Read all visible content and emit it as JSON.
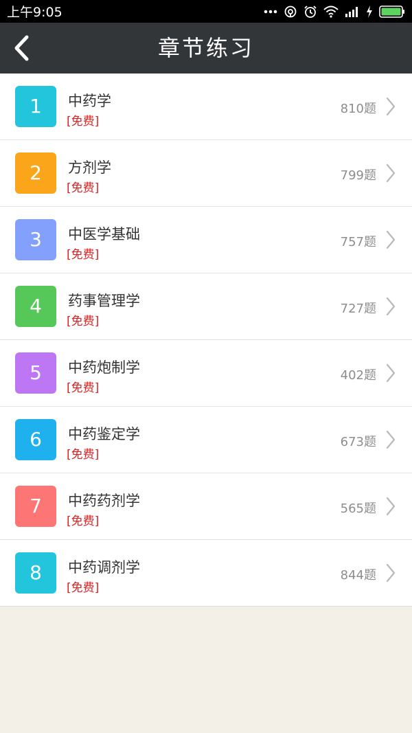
{
  "status_bar": {
    "time": "上午9:05",
    "icons": [
      "more-dots-icon",
      "sync-icon",
      "alarm-icon",
      "wifi-icon",
      "signal-icon",
      "charging-icon",
      "battery-icon"
    ]
  },
  "header": {
    "title": "章节练习",
    "back_icon": "chevron-left-icon"
  },
  "chapters": [
    {
      "num": "1",
      "name": "中药学",
      "tag": "[免费]",
      "count": "810题",
      "color": "#22c5db"
    },
    {
      "num": "2",
      "name": "方剂学",
      "tag": "[免费]",
      "count": "799题",
      "color": "#fba61a"
    },
    {
      "num": "3",
      "name": "中医学基础",
      "tag": "[免费]",
      "count": "757题",
      "color": "#84a0fd"
    },
    {
      "num": "4",
      "name": "药事管理学",
      "tag": "[免费]",
      "count": "727题",
      "color": "#55c859"
    },
    {
      "num": "5",
      "name": "中药炮制学",
      "tag": "[免费]",
      "count": "402题",
      "color": "#bd77f5"
    },
    {
      "num": "6",
      "name": "中药鉴定学",
      "tag": "[免费]",
      "count": "673题",
      "color": "#1fb1ee"
    },
    {
      "num": "7",
      "name": "中药药剂学",
      "tag": "[免费]",
      "count": "565题",
      "color": "#fc7676"
    },
    {
      "num": "8",
      "name": "中药调剂学",
      "tag": "[免费]",
      "count": "844题",
      "color": "#22c5db"
    }
  ],
  "colors": {
    "status_bar_bg": "#000000",
    "nav_bg": "#333638",
    "page_bg": "#f3f0e8",
    "tag_red": "#e02020",
    "count_gray": "#8d8d8d",
    "battery_green": "#5fd35f"
  }
}
